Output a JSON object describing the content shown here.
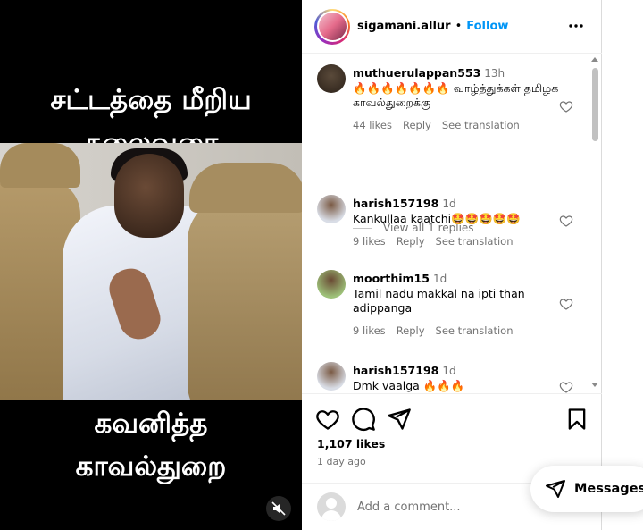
{
  "media": {
    "caption_top_line1": "சட்டத்தை மீறிய",
    "caption_top_line2": "தலைவரை",
    "caption_bottom_line1": "கவனித்த",
    "caption_bottom_line2": "காவல்துறை"
  },
  "post": {
    "username": "sigamani.allur",
    "separator": "•",
    "follow_label": "Follow",
    "more_label": "•••",
    "likes": "1,107 likes",
    "time_ago": "1 day ago"
  },
  "comments": [
    {
      "username": "muthuerulappan553",
      "time": "13h",
      "text": "🔥🔥🔥🔥🔥🔥🔥 வாழ்த்துக்கள் தமிழக காவல்துறைக்கு",
      "likes": "44 likes",
      "reply": "Reply",
      "translate": "See translation"
    },
    {
      "username": "harish157198",
      "time": "1d",
      "text": "Kankullaa kaatchi🤩🤩🤩🤩🤩",
      "likes": "9 likes",
      "reply": "Reply",
      "translate": "See translation"
    },
    {
      "username": "moorthim15",
      "time": "1d",
      "text": "Tamil nadu makkal na ipti than adippanga",
      "likes": "9 likes",
      "reply": "Reply",
      "translate": "See translation"
    },
    {
      "username": "harish157198",
      "time": "1d",
      "text": "Dmk vaalga 🔥🔥🔥"
    }
  ],
  "view_replies": "View all 1 replies",
  "add_comment": {
    "placeholder": "Add a comment..."
  },
  "messages_label": "Messages",
  "colors": {
    "link": "#0095f6",
    "muted": "#737373",
    "border": "#efefef"
  }
}
